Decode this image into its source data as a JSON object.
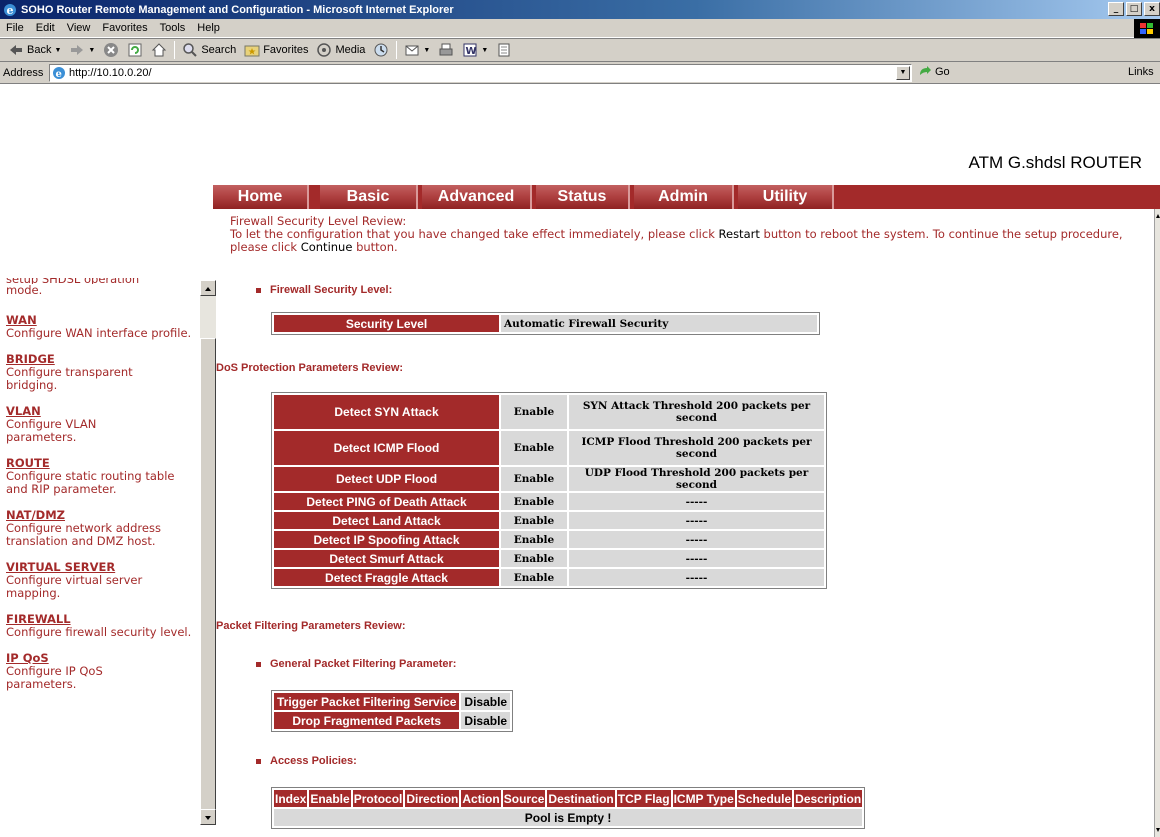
{
  "window": {
    "title": "SOHO Router Remote Management and Configuration - Microsoft Internet Explorer",
    "buttons": [
      "_",
      "□",
      "x"
    ]
  },
  "menu": [
    "File",
    "Edit",
    "View",
    "Favorites",
    "Tools",
    "Help"
  ],
  "toolbar": {
    "back": "Back",
    "search": "Search",
    "favorites": "Favorites",
    "media": "Media"
  },
  "address": {
    "label": "Address",
    "url": "http://10.10.0.20/",
    "go": "Go",
    "links": "Links"
  },
  "header": {
    "product": "ATM G.shdsl ROUTER"
  },
  "nav": [
    "Home",
    "Basic",
    "Advanced",
    "Status",
    "Admin",
    "Utility"
  ],
  "sidebar": {
    "clipped_top": "setup SHDSL operation",
    "clipped_tail": "mode.",
    "items": [
      {
        "title": "WAN",
        "desc": "Configure WAN interface profile."
      },
      {
        "title": "BRIDGE",
        "desc": "Configure transparent bridging."
      },
      {
        "title": "VLAN",
        "desc": "Configure VLAN parameters."
      },
      {
        "title": "ROUTE",
        "desc": "Configure static routing table and RIP parameter."
      },
      {
        "title": "NAT/DMZ",
        "desc": "Configure network address translation and DMZ host."
      },
      {
        "title": "VIRTUAL SERVER",
        "desc": "Configure virtual server mapping."
      },
      {
        "title": "FIREWALL",
        "desc": "Configure firewall security level."
      },
      {
        "title": "IP QoS",
        "desc": "Configure IP QoS parameters."
      }
    ]
  },
  "intro": {
    "line1": "Firewall Security Level Review:",
    "part_a": "To let the configuration that you have changed take effect immediately,  please click ",
    "restart": "Restart",
    "part_b": " button to reboot the system.  To continue the setup procedure, please click ",
    "continue": "Continue",
    "part_c": " button."
  },
  "firewall": {
    "heading": "Firewall Security Level:",
    "label": "Security Level",
    "value": "Automatic Firewall Security"
  },
  "dos": {
    "heading": "DoS Protection Parameters Review:",
    "rows": [
      {
        "name": "Detect SYN Attack",
        "state": "Enable",
        "detail": "SYN Attack Threshold 200 packets per second"
      },
      {
        "name": "Detect ICMP Flood",
        "state": "Enable",
        "detail": "ICMP Flood Threshold 200 packets per second"
      },
      {
        "name": "Detect UDP Flood",
        "state": "Enable",
        "detail": "UDP Flood Threshold 200 packets per second"
      },
      {
        "name": "Detect PING of Death Attack",
        "state": "Enable",
        "detail": "-----"
      },
      {
        "name": "Detect Land Attack",
        "state": "Enable",
        "detail": "-----"
      },
      {
        "name": "Detect IP Spoofing Attack",
        "state": "Enable",
        "detail": "-----"
      },
      {
        "name": "Detect Smurf Attack",
        "state": "Enable",
        "detail": "-----"
      },
      {
        "name": "Detect Fraggle Attack",
        "state": "Enable",
        "detail": "-----"
      }
    ]
  },
  "packet": {
    "heading": "Packet Filtering Parameters Review:",
    "general_heading": "General Packet Filtering Parameter:",
    "rows": [
      {
        "name": "Trigger Packet Filtering Service",
        "value": "Disable"
      },
      {
        "name": "Drop Fragmented Packets",
        "value": "Disable"
      }
    ],
    "access_heading": "Access Policies:",
    "columns": [
      "Index",
      "Enable",
      "Protocol",
      "Direction",
      "Action",
      "Source",
      "Destination",
      "TCP Flag",
      "ICMP Type",
      "Schedule",
      "Description"
    ],
    "empty": "Pool is Empty !"
  },
  "colors": {
    "brand": "#a32a2a",
    "cell": "#d9d9d9",
    "titlebar": "#0a246a"
  }
}
